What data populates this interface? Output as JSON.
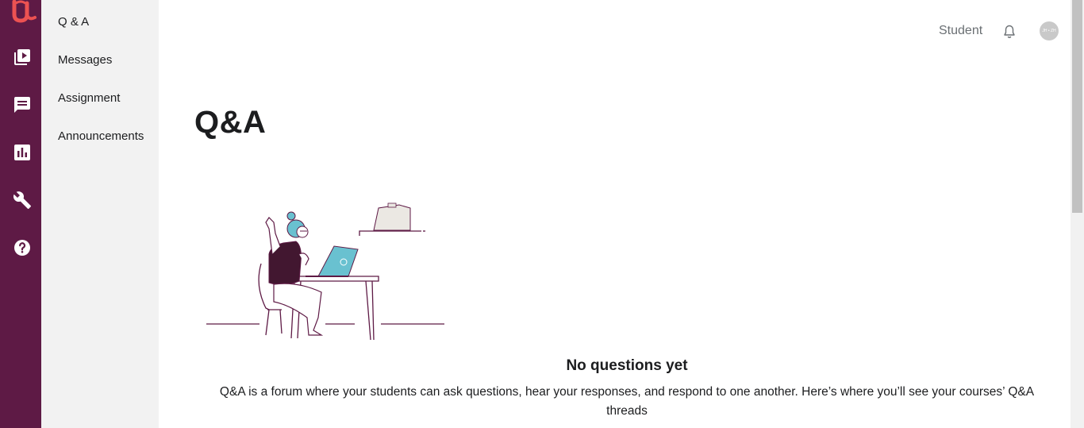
{
  "brand": {
    "logo_icon": "udemy-u-logo-icon",
    "color": "#ec5252"
  },
  "rail": {
    "background": "#5e1a45",
    "items": [
      {
        "name": "courses",
        "icon": "video-library-icon"
      },
      {
        "name": "communication",
        "icon": "chat-icon"
      },
      {
        "name": "performance",
        "icon": "bar-chart-icon"
      },
      {
        "name": "tools",
        "icon": "wrench-icon"
      },
      {
        "name": "resources",
        "icon": "help-icon"
      }
    ]
  },
  "subnav": {
    "items": [
      {
        "label": "Q & A"
      },
      {
        "label": "Messages"
      },
      {
        "label": "Assignment"
      },
      {
        "label": "Announcements"
      }
    ]
  },
  "topbar": {
    "student_label": "Student",
    "notifications_icon": "bell-icon",
    "avatar_initials": "JH • ZH"
  },
  "main": {
    "title": "Q&A",
    "empty_state": {
      "title": "No questions yet",
      "description": "Q&A is a forum where your students can ask questions, hear your responses, and respond to one another. Here’s where you’ll see your courses’ Q&A threads"
    }
  }
}
